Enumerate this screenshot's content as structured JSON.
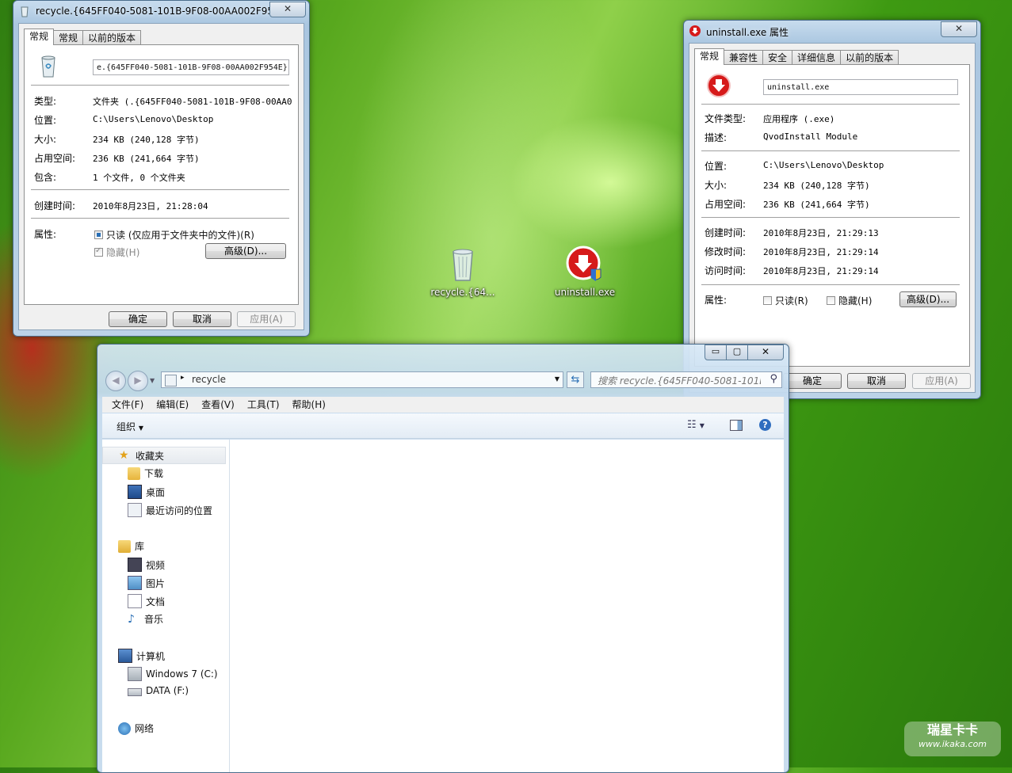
{
  "desktop": {
    "icons": [
      {
        "label": "recycle.{64..."
      },
      {
        "label": "uninstall.exe"
      }
    ],
    "watermark": {
      "main": "瑞星卡卡",
      "sub": "www.ikaka.com"
    }
  },
  "recycle_props": {
    "title": "recycle.{645FF040-5081-101B-9F08-00AA002F95...",
    "close": "✕",
    "tabs": [
      "常规",
      "常规",
      "以前的版本"
    ],
    "name_value": "e.{645FF040-5081-101B-9F08-00AA002F954E}",
    "rows": [
      {
        "label": "类型:",
        "value": "文件夹 (.{645FF040-5081-101B-9F08-00AA002"
      },
      {
        "label": "位置:",
        "value": "C:\\Users\\Lenovo\\Desktop"
      },
      {
        "label": "大小:",
        "value": "234 KB (240,128 字节)"
      },
      {
        "label": "占用空间:",
        "value": "236 KB (241,664 字节)"
      },
      {
        "label": "包含:",
        "value": "1 个文件, 0 个文件夹"
      },
      {
        "label": "创建时间:",
        "value": "2010年8月23日, 21:28:04"
      }
    ],
    "attr_label": "属性:",
    "readonly_label": "只读 (仅应用于文件夹中的文件)(R)",
    "hidden_label": "隐藏(H)",
    "advanced_btn": "高级(D)...",
    "ok": "确定",
    "cancel": "取消",
    "apply": "应用(A)"
  },
  "uninstall_props": {
    "title": "uninstall.exe 属性",
    "close": "✕",
    "tabs": [
      "常规",
      "兼容性",
      "安全",
      "详细信息",
      "以前的版本"
    ],
    "name_value": "uninstall.exe",
    "rows_a": [
      {
        "label": "文件类型:",
        "value": "应用程序 (.exe)"
      },
      {
        "label": "描述:",
        "value": "QvodInstall Module"
      }
    ],
    "rows_b": [
      {
        "label": "位置:",
        "value": "C:\\Users\\Lenovo\\Desktop"
      },
      {
        "label": "大小:",
        "value": "234 KB (240,128 字节)"
      },
      {
        "label": "占用空间:",
        "value": "236 KB (241,664 字节)"
      }
    ],
    "rows_c": [
      {
        "label": "创建时间:",
        "value": "2010年8月23日, 21:29:13"
      },
      {
        "label": "修改时间:",
        "value": "2010年8月23日, 21:29:14"
      },
      {
        "label": "访问时间:",
        "value": "2010年8月23日, 21:29:14"
      }
    ],
    "attr_label": "属性:",
    "readonly_label": "只读(R)",
    "hidden_label": "隐藏(H)",
    "advanced_btn": "高级(D)...",
    "ok": "确定",
    "cancel": "取消",
    "apply": "应用(A)"
  },
  "explorer": {
    "address": "recycle",
    "search_placeholder": "搜索 recycle.{645FF040-5081-101B...",
    "menu": [
      "文件(F)",
      "编辑(E)",
      "查看(V)",
      "工具(T)",
      "帮助(H)"
    ],
    "organize": "组织",
    "nav": {
      "favorites": "收藏夹",
      "downloads": "下载",
      "desktop": "桌面",
      "recent": "最近访问的位置",
      "libraries": "库",
      "videos": "视频",
      "pictures": "图片",
      "documents": "文档",
      "music": "音乐",
      "computer": "计算机",
      "drive_c": "Windows 7 (C:)",
      "drive_f": "DATA (F:)",
      "network": "网络"
    }
  }
}
